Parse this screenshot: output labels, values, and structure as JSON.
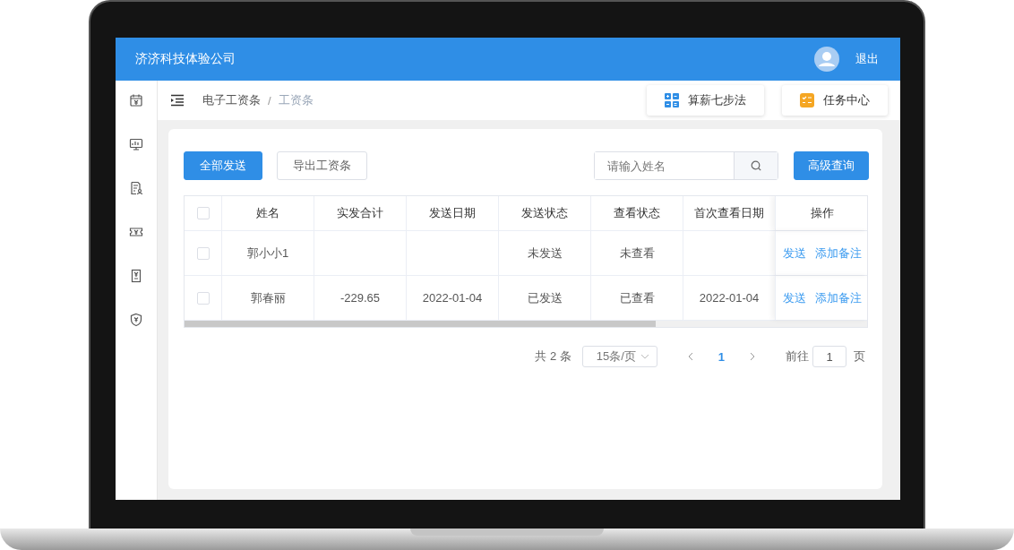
{
  "header": {
    "company": "济济科技体验公司",
    "logout": "退出"
  },
  "breadcrumb": {
    "items": [
      "电子工资条",
      "工资条"
    ],
    "separator": "/"
  },
  "top_buttons": [
    "算薪七步法",
    "任务中心"
  ],
  "toolbar": {
    "buttons": [
      {
        "label": "全部发送",
        "kind": "primary"
      },
      {
        "label": "导出工资条",
        "kind": "plain"
      }
    ],
    "search": {
      "placeholder": "请输入姓名"
    },
    "advanced": "高级查询"
  },
  "table": {
    "header_checked": false,
    "columns": [
      "姓名",
      "实发合计",
      "发送日期",
      "发送状态",
      "查看状态",
      "首次查看日期",
      "操作"
    ],
    "rows": [
      {
        "checked": false,
        "cells": [
          "郭小小1",
          "",
          "",
          "未发送",
          "未查看",
          ""
        ],
        "actions": [
          "发送",
          "添加备注"
        ]
      },
      {
        "checked": false,
        "cells": [
          "郭春丽",
          "-229.65",
          "2022-01-04",
          "已发送",
          "已查看",
          "2022-01-04"
        ],
        "actions": [
          "发送",
          "添加备注"
        ]
      }
    ]
  },
  "pagination": {
    "total": "共 2 条",
    "page_size": "15条/页",
    "pages": [
      {
        "label": "1",
        "selected": true
      }
    ],
    "goto_label": "前往",
    "goto_value": "1",
    "goto_suffix": "页"
  }
}
